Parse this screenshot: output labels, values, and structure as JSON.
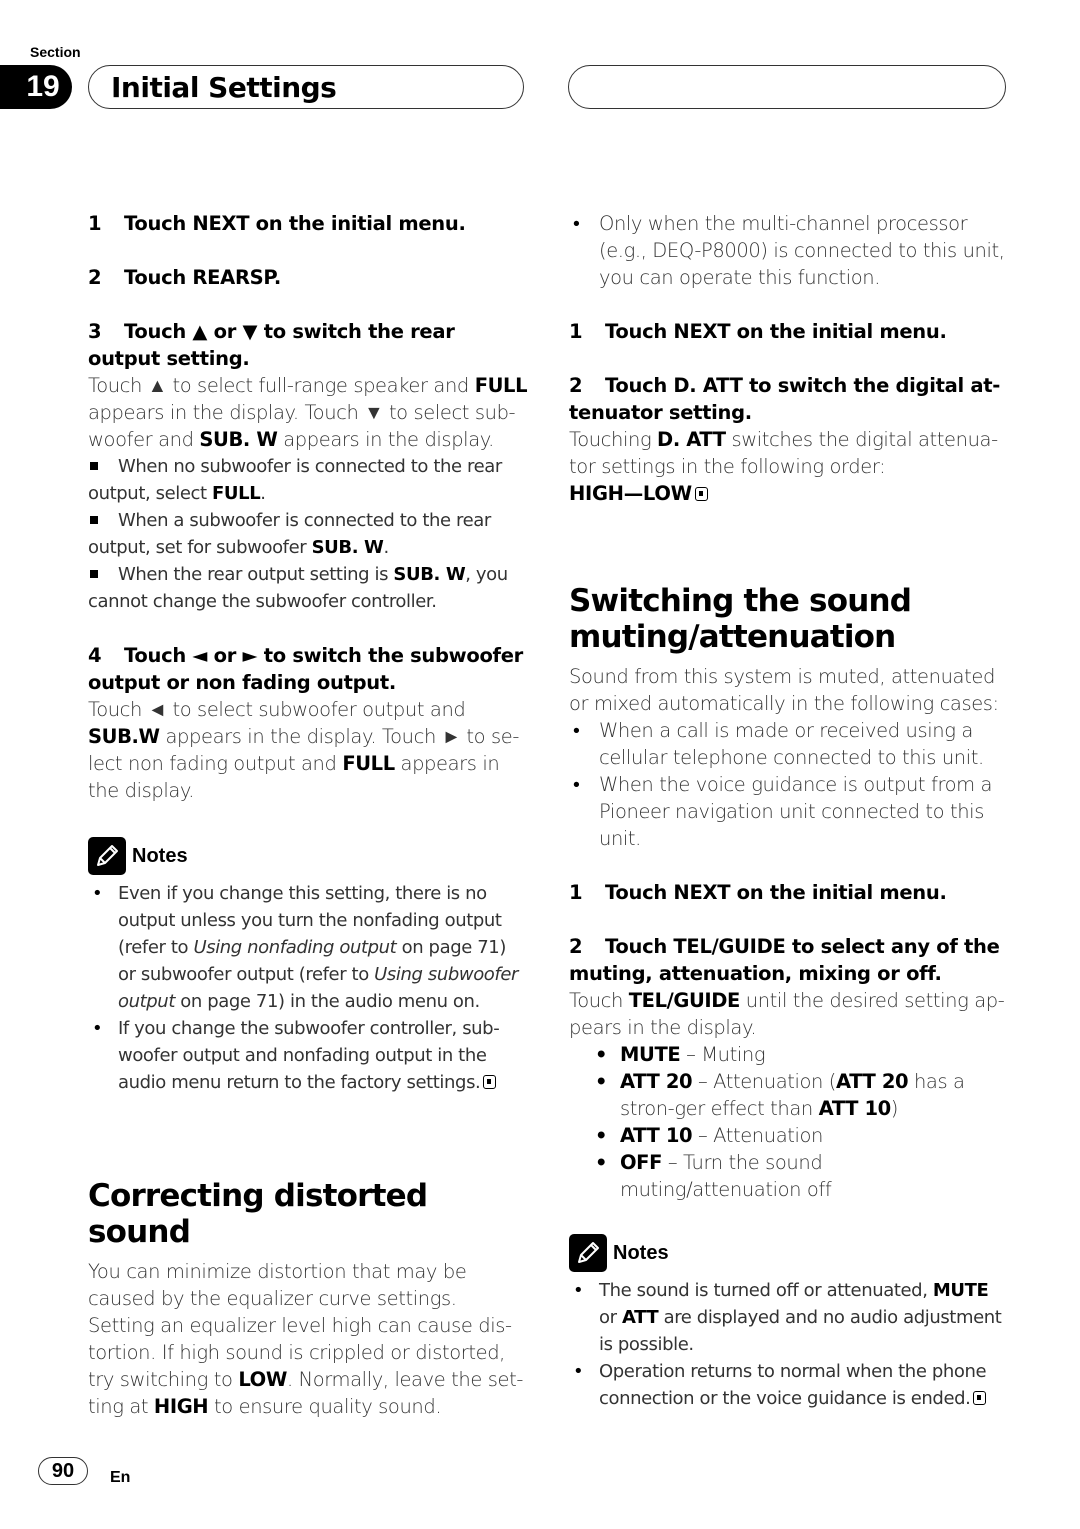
{
  "header": {
    "section_label": "Section",
    "section_number": "19",
    "title": "Initial Settings"
  },
  "left": {
    "steps1": [
      {
        "num": "1",
        "text": "Touch NEXT on the initial menu."
      },
      {
        "num": "2",
        "text": "Touch REARSP."
      }
    ],
    "step3": {
      "num": "3",
      "pre": "Touch ",
      "up": "▲",
      "mid": " or ",
      "down": "▼",
      "post": " to switch the rear output setting."
    },
    "step3_body": {
      "t1": "Touch ",
      "up": "▲",
      "t2": " to select full-range speaker and ",
      "b1": "FULL",
      "t3": " appears in the display. Touch ",
      "down": "▼",
      "t4": " to select sub-woofer and ",
      "b2": "SUB. W",
      "t5": " appears in the display."
    },
    "step3_notes": [
      {
        "t1": "When no subwoofer is connected to the rear output, select ",
        "b": "FULL",
        "t2": "."
      },
      {
        "t1": "When a subwoofer is connected to the rear output, set for subwoofer ",
        "b": "SUB. W",
        "t2": "."
      },
      {
        "t1": "When the rear output setting is ",
        "b": "SUB. W",
        "t2": ", you cannot change the subwoofer controller."
      }
    ],
    "step4": {
      "num": "4",
      "pre": "Touch ",
      "left": "◄",
      "mid": " or ",
      "right": "►",
      "post": " to switch the subwoofer output or non fading output."
    },
    "step4_body": {
      "t1": "Touch ",
      "left": "◄",
      "t2": " to select subwoofer output and ",
      "b1": "SUB.W",
      "t3": " appears in the display. Touch ",
      "right": "►",
      "t4": " to se-lect non fading output and ",
      "b2": "FULL",
      "t5": " appears in the display."
    },
    "notes_title": "Notes",
    "notes": {
      "n1": {
        "t1": "Even if you change this setting, there is no output unless you turn the nonfading output (refer to ",
        "i1": "Using nonfading output",
        "t2": " on page 71) or subwoofer output (refer to ",
        "i2": "Using subwoofer output",
        "t3": " on page 71) in the audio menu on."
      },
      "n2": {
        "t1": "If you change the subwoofer controller, sub-woofer output and nonfading output in the audio menu return to the factory settings."
      }
    },
    "section2_title": "Correcting distorted sound",
    "section2_body": {
      "t1": "You can minimize distortion that may be caused by the equalizer curve settings. Setting an equalizer level high can cause dis-tortion. If high sound is crippled or distorted, try switching to ",
      "b1": "LOW",
      "t2": ". Normally, leave the set-ting at ",
      "b2": "HIGH",
      "t3": " to ensure quality sound."
    }
  },
  "right": {
    "intro_bullet": "Only when the multi-channel processor (e.g., DEQ-P8000) is connected to this unit, you can operate this function.",
    "steps_a": {
      "s1": {
        "num": "1",
        "text": "Touch NEXT on the initial menu."
      },
      "s2": {
        "num": "2",
        "text": "Touch D. ATT to switch the digital at-tenuator setting."
      }
    },
    "s2_body": {
      "t1": "Touching ",
      "b1": "D. ATT",
      "t2": " switches the digital attenua-tor settings in the following order:"
    },
    "order": "HIGH—LOW",
    "section_title_1": "Switching the sound",
    "section_title_2": "muting/attenuation",
    "section_intro": "Sound from this system is muted, attenuated or mixed automatically in the following cases:",
    "cases": [
      "When a call is made or received using a cellular telephone connected to this unit.",
      "When the voice guidance is output from a Pioneer navigation unit connected to this unit."
    ],
    "steps_b": {
      "s1": {
        "num": "1",
        "text": "Touch NEXT on the initial menu."
      },
      "s2": {
        "num": "2",
        "text": "Touch TEL/GUIDE to select any of the muting, attenuation, mixing or off."
      }
    },
    "tel_body": {
      "t1": "Touch ",
      "b1": "TEL/GUIDE",
      "t2": " until the desired setting ap-pears in the display."
    },
    "options": {
      "o1": {
        "b": "MUTE",
        "t": " – Muting"
      },
      "o2": {
        "b": "ATT 20",
        "t1": " – Attenuation (",
        "b2": "ATT 20",
        "t2": " has a stron-ger effect than ",
        "b3": "ATT 10",
        "t3": ")"
      },
      "o3": {
        "b": "ATT 10",
        "t": " – Attenuation"
      },
      "o4": {
        "b": "OFF",
        "t": " – Turn the sound muting/attenuation off"
      }
    },
    "notes_title": "Notes",
    "notes": {
      "n1": {
        "t1": "The sound is turned off or attenuated, ",
        "b1": "MUTE",
        "t2": " or ",
        "b2": "ATT",
        "t3": " are displayed and no audio adjustment is possible."
      },
      "n2": {
        "t1": "Operation returns to normal when the phone connection or the voice guidance is ended."
      }
    }
  },
  "footer": {
    "page_number": "90",
    "language": "En"
  }
}
